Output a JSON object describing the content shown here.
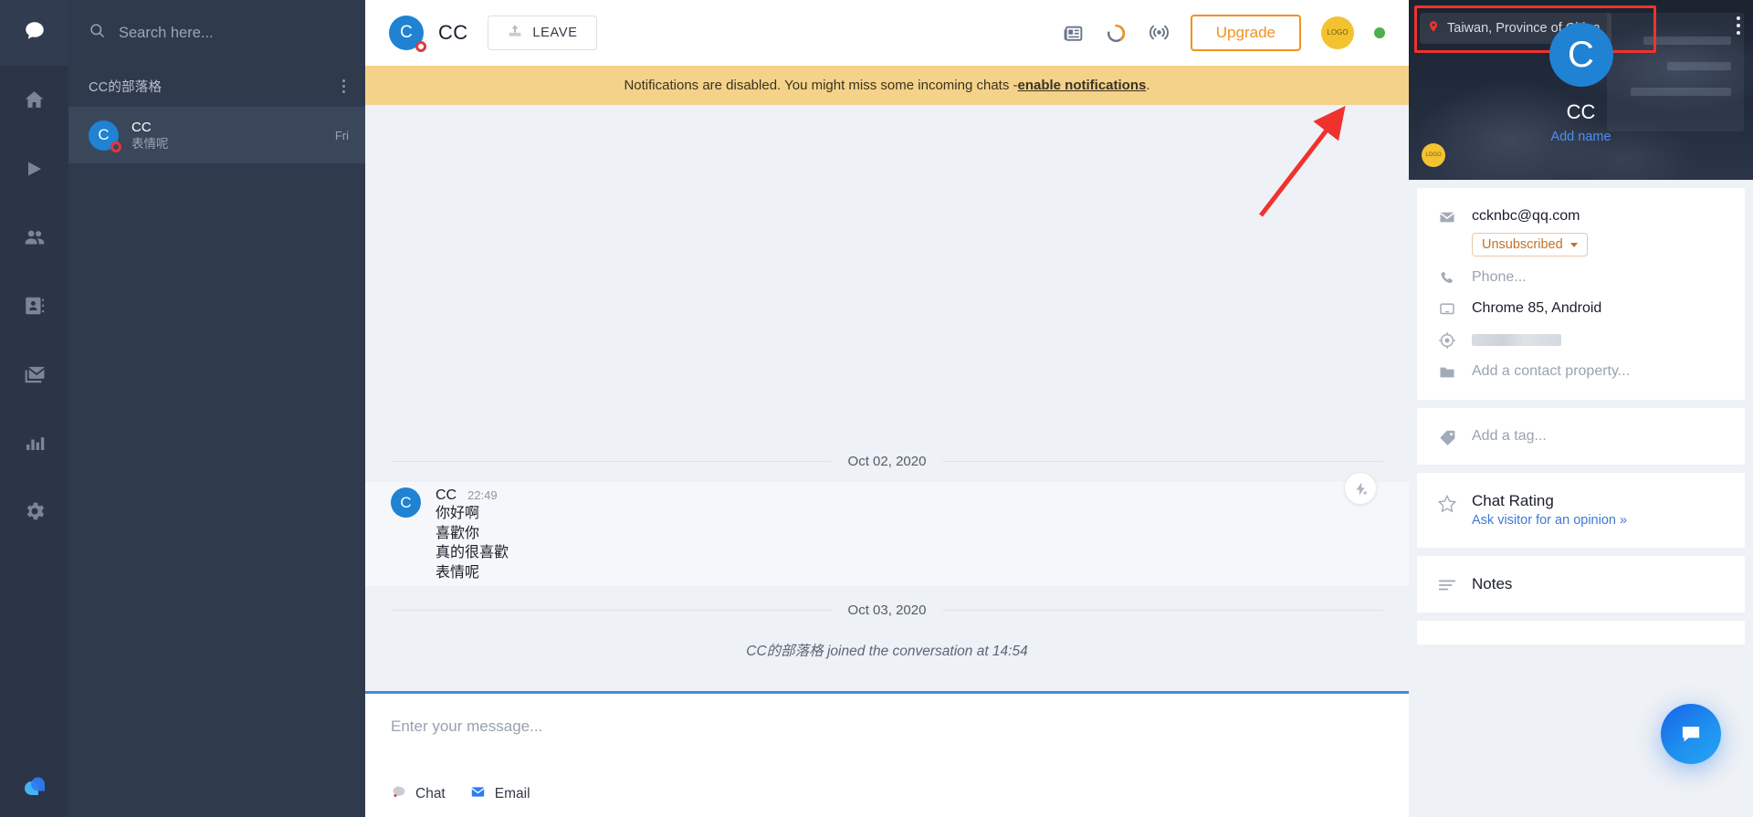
{
  "rail": {
    "items": [
      {
        "name": "chats-icon",
        "label": "Chats"
      },
      {
        "name": "home-icon",
        "label": "Home"
      },
      {
        "name": "traffic-icon",
        "label": "Traffic"
      },
      {
        "name": "team-icon",
        "label": "Team"
      },
      {
        "name": "contacts-icon",
        "label": "Contacts"
      },
      {
        "name": "mail-icon",
        "label": "Archives"
      },
      {
        "name": "reports-icon",
        "label": "Reports"
      },
      {
        "name": "settings-icon",
        "label": "Settings"
      }
    ],
    "logo_name": "livechat-logo"
  },
  "sidebar": {
    "search": {
      "placeholder": "Search here...",
      "value": ""
    },
    "group": {
      "title": "CC的部落格"
    },
    "conversations": [
      {
        "avatar_letter": "C",
        "name": "CC",
        "preview": "表情呢",
        "time": "Fri"
      }
    ]
  },
  "header": {
    "avatar_letter": "C",
    "title": "CC",
    "leave_label": "LEAVE",
    "icons": [
      {
        "name": "news-icon"
      },
      {
        "name": "activity-ring-icon"
      },
      {
        "name": "broadcast-icon"
      }
    ],
    "upgrade_label": "Upgrade",
    "user_avatar_text": "LOGO",
    "status": "online"
  },
  "banner": {
    "text_before": "Notifications are disabled. You might miss some incoming chats - ",
    "link": "enable notifications",
    "text_after": "."
  },
  "conversation": {
    "dates": {
      "first": "Oct 02, 2020",
      "second": "Oct 03, 2020"
    },
    "message": {
      "avatar_letter": "C",
      "author": "CC",
      "time": "22:49",
      "lines": [
        "你好啊",
        "喜歡你",
        "真的很喜歡",
        "表情呢"
      ]
    },
    "joined_note": "CC的部落格 joined the conversation at 14:54"
  },
  "composer": {
    "placeholder": "Enter your message...",
    "value": "",
    "tabs": [
      {
        "name": "chat-tab",
        "label": "Chat"
      },
      {
        "name": "email-tab",
        "label": "Email"
      }
    ]
  },
  "rightpanel": {
    "location": "Taiwan, Province of China",
    "avatar_letter": "C",
    "name": "CC",
    "add_name_label": "Add name",
    "badge_text": "LOGO",
    "properties": [
      {
        "icon": "envelope-icon",
        "value": "ccknbc@qq.com",
        "muted": false
      },
      {
        "icon": "phone-icon",
        "value": "Phone...",
        "muted": true
      },
      {
        "icon": "device-icon",
        "value": "Chrome 85, Android",
        "muted": false
      },
      {
        "icon": "target-icon",
        "value": "",
        "muted": true,
        "redacted": true
      },
      {
        "icon": "folder-icon",
        "value": "Add a contact property...",
        "muted": true
      }
    ],
    "subscription_label": "Unsubscribed",
    "tag_placeholder": "Add a tag...",
    "rating": {
      "title": "Chat Rating",
      "link": "Ask visitor for an opinion »"
    },
    "notes_title": "Notes"
  },
  "colors": {
    "rail_bg": "#2b3547",
    "list_bg": "#2f3a4d",
    "accent_blue": "#1f82d2",
    "upgrade_orange": "#f2921d",
    "banner_yellow": "#f5d28a",
    "highlight_red": "#f0322e",
    "online_green": "#4caf50",
    "link_blue": "#3f79d0"
  }
}
